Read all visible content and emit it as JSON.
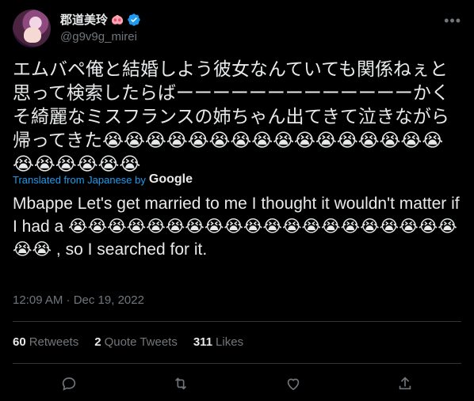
{
  "author": {
    "display_name": "郡道美玲",
    "name_emoji": "🐽",
    "handle": "@g9v9g_mirei"
  },
  "tweet": {
    "text_jp": "エムバペ俺と結婚しよう彼女なんていても関係ねぇと思って検索したらばーーーーーーーーーーーーーかくそ綺麗なミスフランスの姉ちゃん出てきて泣きながら帰ってきた😭😭😭😭😭😭😭😭😭😭😭😭😭😭😭😭😭😭😭😭😭😭",
    "translated_label": "Translated from Japanese by",
    "translator": "Google",
    "text_en": "Mbappe Let's get married to me I thought it wouldn't matter if I had a 😭😭😭😭😭😭😭😭😭😭😭😭😭😭😭😭😭😭😭😭😭😭 , so I searched for it.",
    "timestamp": "12:09 AM · Dec 19, 2022"
  },
  "stats": {
    "retweets_count": "60",
    "retweets_label": "Retweets",
    "quotes_count": "2",
    "quotes_label": "Quote Tweets",
    "likes_count": "311",
    "likes_label": "Likes"
  },
  "actions": [
    "reply-icon",
    "retweet-icon",
    "like-icon",
    "share-icon"
  ],
  "colors": {
    "background": "#000000",
    "link": "#1d9bf0",
    "muted": "#71767b",
    "text": "#e7e9ea"
  }
}
